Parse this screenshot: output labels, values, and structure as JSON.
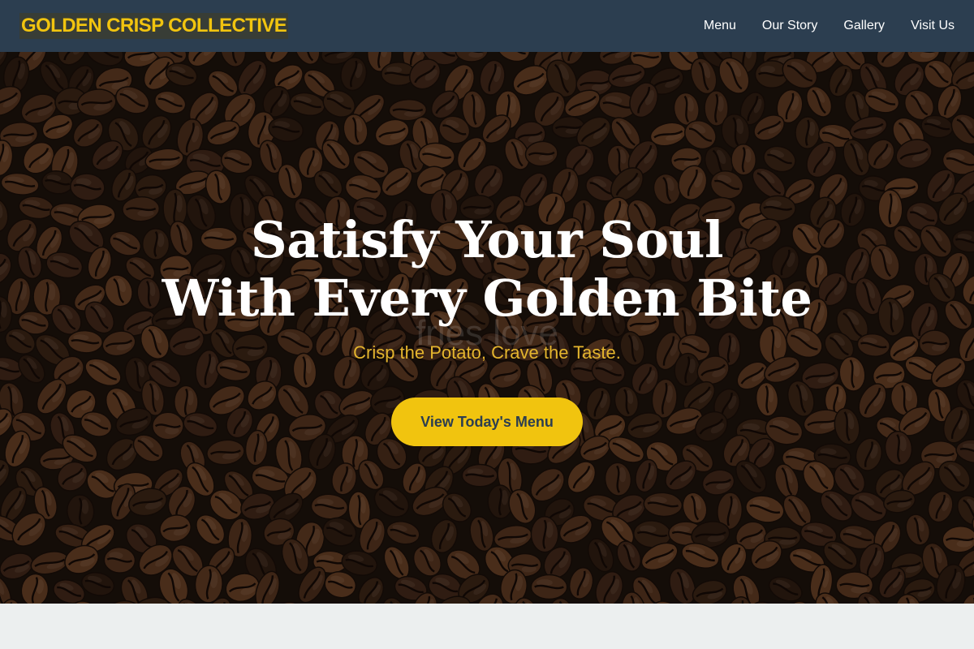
{
  "navbar": {
    "brand": "GOLDEN CRISP COLLECTIVE",
    "links": [
      "Menu",
      "Our Story",
      "Gallery",
      "Visit Us"
    ]
  },
  "hero": {
    "title_line1": "Satisfy Your Soul",
    "title_line2": "With Every Golden Bite",
    "ghost_text": "fries love",
    "tagline": "Crisp the Potato, Crave the Taste.",
    "cta_label": "View Today's Menu",
    "background": "coffee-beans-photo"
  },
  "colors": {
    "navbar_bg": "#2c3e50",
    "accent_gold": "#f1c40f",
    "tagline_gold": "#e4b52e",
    "cta_text": "#2c3e50",
    "page_bg": "#ecefef"
  }
}
